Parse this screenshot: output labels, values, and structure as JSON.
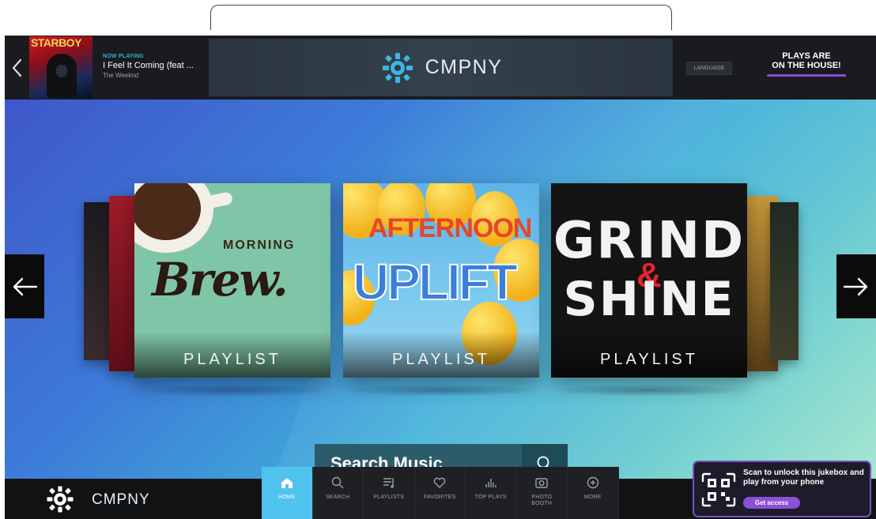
{
  "now_playing": {
    "album_title": "STARBOY",
    "label": "NOW PLAYING",
    "title": "I Feel It Coming (feat ...",
    "artist": "The Weeknd"
  },
  "brand": {
    "name": "CMPNY"
  },
  "header": {
    "language_label": "LANGUAGE",
    "promo_text_line1": "PLAYS ARE",
    "promo_text_line2": "ON THE HOUSE!"
  },
  "playlists": [
    {
      "art_line1": "MORNING",
      "art_line2": "Brew.",
      "label": "PLAYLIST"
    },
    {
      "art_line1": "AFTERNOON",
      "art_line2": "UPLIFT",
      "label": "PLAYLIST"
    },
    {
      "art_line1": "GRIND",
      "art_amp": "&",
      "art_line2": "SHINE",
      "label": "PLAYLIST"
    }
  ],
  "search": {
    "label": "Search Music"
  },
  "nav": {
    "active": "HOME",
    "items": [
      {
        "label": "HOME",
        "icon": "home-icon"
      },
      {
        "label": "SEARCH",
        "icon": "search-icon"
      },
      {
        "label": "PLAYLISTS",
        "icon": "playlists-icon"
      },
      {
        "label": "FAVORITES",
        "icon": "heart-icon"
      },
      {
        "label": "TOP PLAYS",
        "icon": "bar-chart-icon"
      },
      {
        "label": "PHOTO BOOTH",
        "icon": "camera-icon"
      },
      {
        "label": "MORE",
        "icon": "plus-circle-icon"
      }
    ]
  },
  "unlock": {
    "text": "Scan to unlock this jukebox and play from your phone",
    "button_label": "Get access"
  },
  "colors": {
    "accent_purple": "#8b4fd8",
    "nav_active": "#4fc3ee",
    "search_bar": "#2c5c6c"
  }
}
